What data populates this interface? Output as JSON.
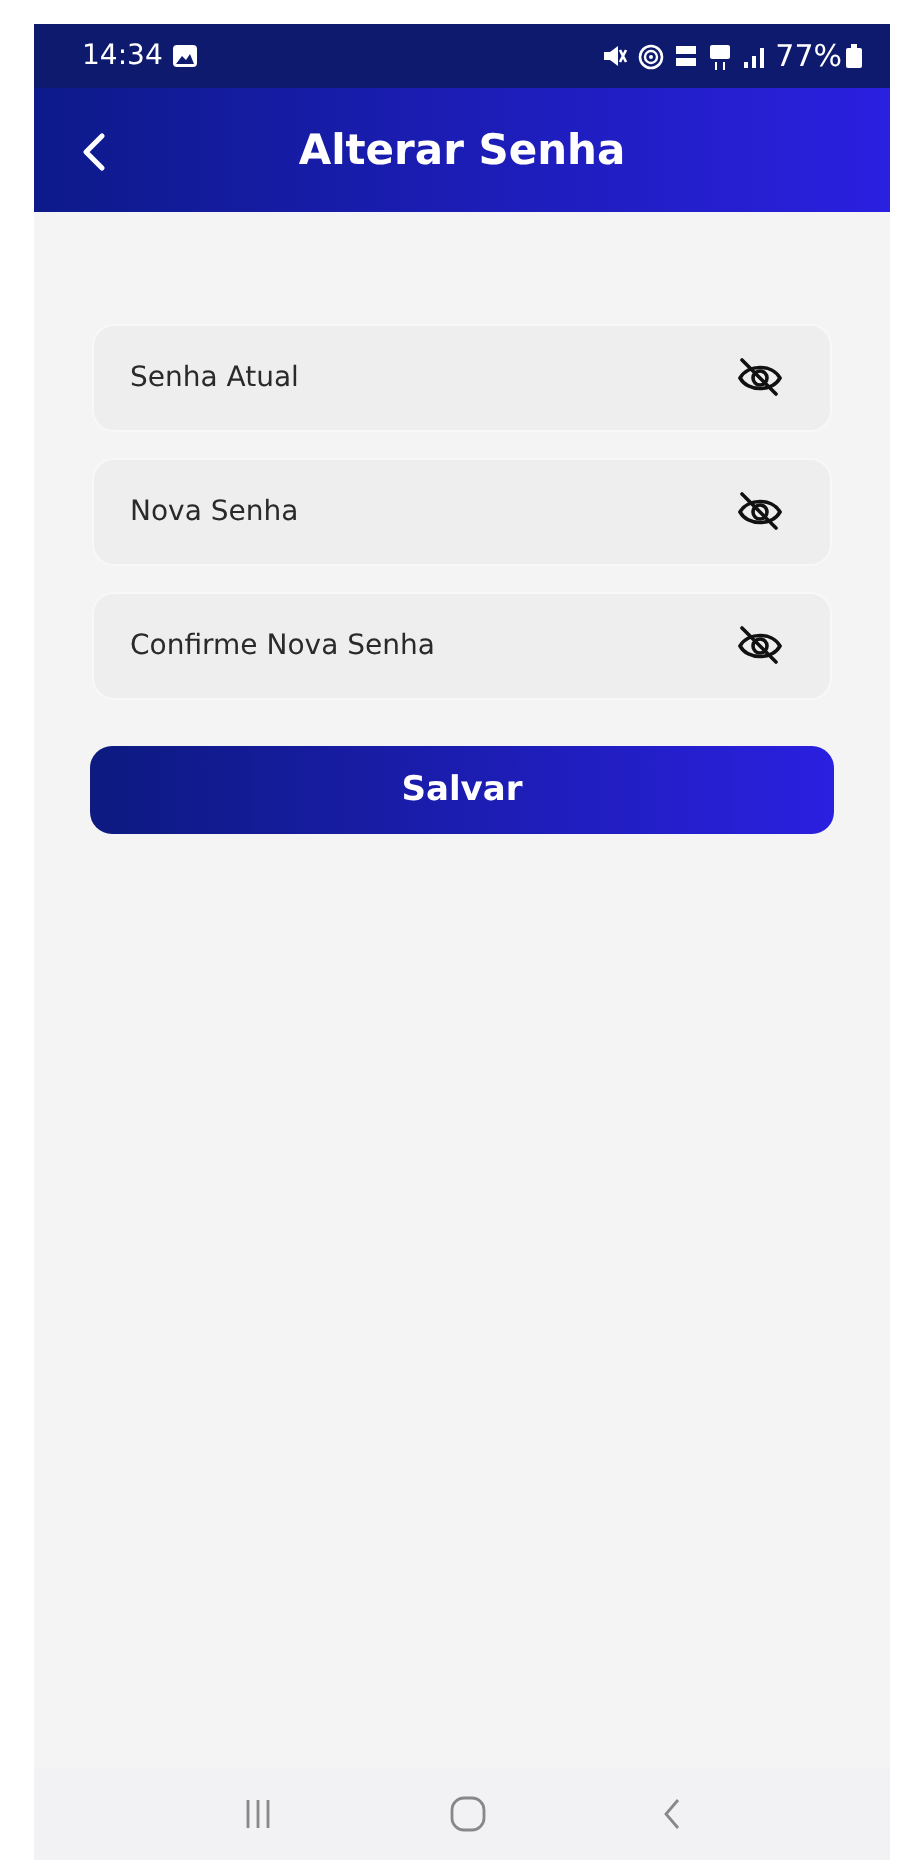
{
  "status_bar": {
    "time": "14:34",
    "battery": "77%"
  },
  "app_bar": {
    "title": "Alterar Senha"
  },
  "fields": [
    {
      "placeholder": "Senha Atual",
      "visible": false
    },
    {
      "placeholder": "Nova Senha",
      "visible": false
    },
    {
      "placeholder": "Confirme Nova Senha",
      "visible": false
    }
  ],
  "save_button": {
    "label": "Salvar"
  }
}
